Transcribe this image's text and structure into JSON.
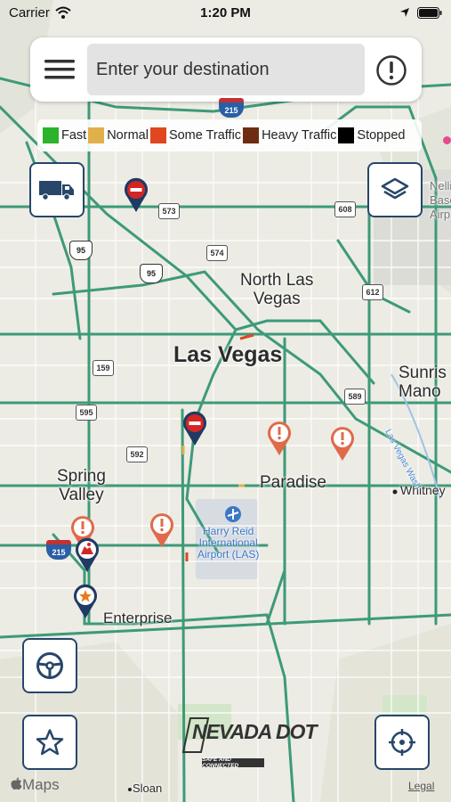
{
  "status_bar": {
    "carrier": "Carrier",
    "time": "1:20 PM"
  },
  "search": {
    "placeholder": "Enter your destination"
  },
  "legend": {
    "items": [
      {
        "label": "Fast",
        "color": "#2bb32b"
      },
      {
        "label": "Normal",
        "color": "#e0b14a"
      },
      {
        "label": "Some Traffic",
        "color": "#e0461f"
      },
      {
        "label": "Heavy Traffic",
        "color": "#6e2d12"
      },
      {
        "label": "Stopped",
        "color": "#000000"
      }
    ]
  },
  "map_labels": {
    "las_vegas": "Las Vegas",
    "north_las_vegas_line1": "North Las",
    "north_las_vegas_line2": "Vegas",
    "sunrise_line1": "Sunris",
    "sunrise_line2": "Mano",
    "nellis_line1": "Nelli",
    "nellis_line2": "Base",
    "nellis_line3": "Airp",
    "spring_valley_line1": "Spring",
    "spring_valley_line2": "Valley",
    "paradise": "Paradise",
    "whitney": "Whitney",
    "enterprise": "Enterprise",
    "sloan": "Sloan",
    "airport_line1": "Harry Reid",
    "airport_line2": "International",
    "airport_line3": "Airport (LAS)",
    "las_vegas_wash": "Las Vegas Wash"
  },
  "route_shields": {
    "i215_top": "215",
    "sr573": "573",
    "sr608": "608",
    "us95_left": "95",
    "us95_center": "95",
    "sr574": "574",
    "sr612": "612",
    "sr159": "159",
    "sr589": "589",
    "sr595": "595",
    "sr592": "592",
    "i215_left": "215"
  },
  "branding": {
    "agency_text": "NEVADA DOT",
    "agency_tagline": "SAFE AND CONNECTED",
    "maps_text": "Maps",
    "legal": "Legal"
  },
  "colors": {
    "road_traffic": "#3d9a78",
    "panel_border": "#27466a",
    "closure_pin": "#d42525",
    "incident_pin": "#e06a4a",
    "pin_body": "#1f3a63"
  }
}
